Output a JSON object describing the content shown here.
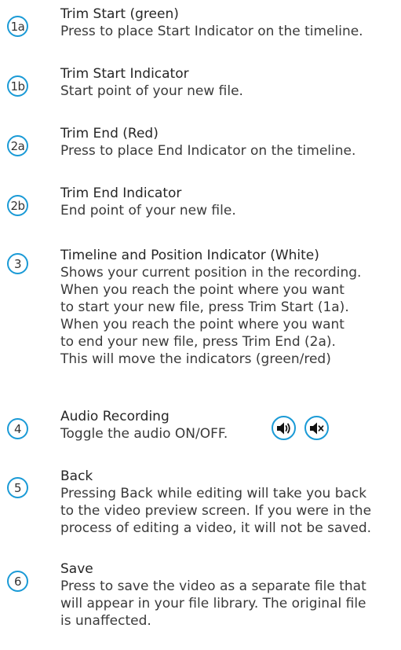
{
  "items": [
    {
      "badge": "1a",
      "title": "Trim Start (green)",
      "lines": [
        "Press to place Start Indicator on the timeline."
      ]
    },
    {
      "badge": "1b",
      "title": "Trim Start Indicator",
      "lines": [
        "Start point of your new file."
      ]
    },
    {
      "badge": "2a",
      "title": "Trim End (Red)",
      "lines": [
        "Press to place End Indicator on the timeline."
      ]
    },
    {
      "badge": "2b",
      "title": "Trim End Indicator",
      "lines": [
        "End point of your new file."
      ]
    },
    {
      "badge": "3",
      "title": "Timeline and Position Indicator (White)",
      "lines": [
        "Shows your current position in the recording.",
        "When you reach the point where you want",
        "to start your new file, press Trim Start (1a).",
        "When you reach the point where you want",
        "to end your new file, press Trim End (2a).",
        "This will move the indicators (green/red)"
      ]
    },
    {
      "badge": "4",
      "title": "Audio Recording",
      "lines": [
        "Toggle the audio ON/OFF."
      ],
      "icons": [
        "speaker-on-icon",
        "speaker-mute-icon"
      ]
    },
    {
      "badge": "5",
      "title": "Back",
      "lines": [
        "Pressing Back while editing will take you back",
        "to the video preview screen. If you were in the",
        "process of editing a video, it will not be saved."
      ]
    },
    {
      "badge": "6",
      "title": "Save",
      "lines": [
        "Press to save the video as a separate file that",
        "will appear in your file library. The original file",
        "is unaffected."
      ]
    }
  ],
  "colors": {
    "badge_border": "#1a9ad6",
    "text": "#333333"
  }
}
